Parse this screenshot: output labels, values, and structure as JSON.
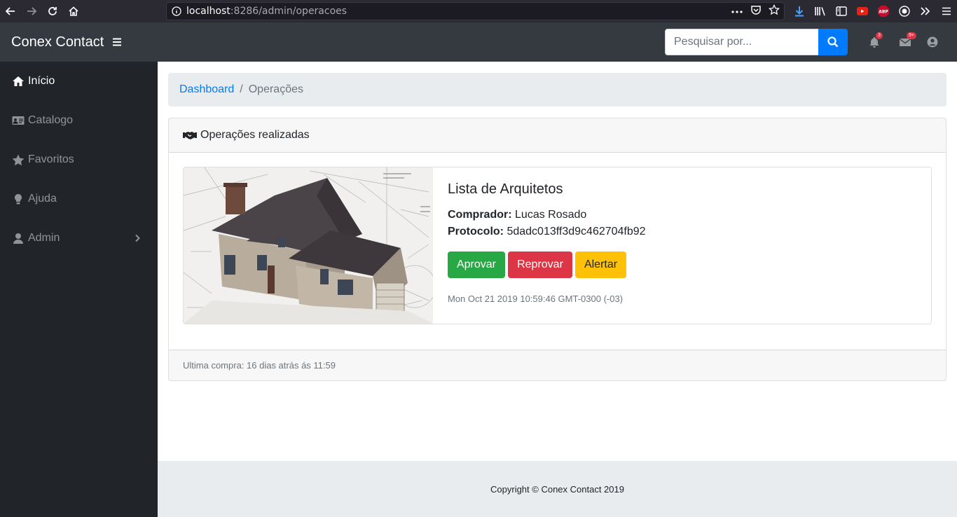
{
  "browser": {
    "url_host": "localhost",
    "url_rest": ":8286/admin/operacoes",
    "badge_adblock": "ABP"
  },
  "navbar": {
    "brand": "Conex Contact",
    "search_placeholder": "Pesquisar por...",
    "notifications_count": "3",
    "messages_count": "9+"
  },
  "sidebar": {
    "items": [
      {
        "label": "Início",
        "icon": "home-icon"
      },
      {
        "label": "Catalogo",
        "icon": "id-card-icon"
      },
      {
        "label": "Favoritos",
        "icon": "star-icon"
      },
      {
        "label": "Ajuda",
        "icon": "lightbulb-icon"
      },
      {
        "label": "Admin",
        "icon": "user-icon"
      }
    ]
  },
  "breadcrumb": {
    "link": "Dashboard",
    "separator": "/",
    "current": "Operações"
  },
  "card": {
    "header": "Operações realizadas",
    "item": {
      "title": "Lista de Arquitetos",
      "buyer_label": "Comprador:",
      "buyer_value": "Lucas Rosado",
      "protocol_label": "Protocolo:",
      "protocol_value": "5dadc013ff3d9c462704fb92",
      "approve_label": "Aprovar",
      "reject_label": "Reprovar",
      "alert_label": "Alertar",
      "timestamp": "Mon Oct 21 2019 10:59:46 GMT-0300 (-03)"
    },
    "footer": "Ultima compra: 16 dias atrás ás 11:59"
  },
  "footer": {
    "copyright": "Copyright © Conex Contact 2019"
  },
  "colors": {
    "primary": "#007bff",
    "success": "#28a745",
    "danger": "#dc3545",
    "warning": "#ffc107",
    "navbar": "#343a40",
    "sidebar": "#212529"
  }
}
